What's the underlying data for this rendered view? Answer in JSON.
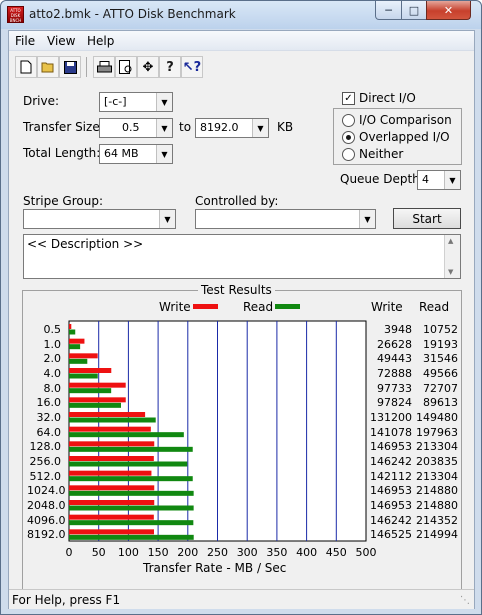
{
  "window": {
    "title": "atto2.bmk - ATTO Disk Benchmark",
    "app_icon_text": "ATTO DISK BNCH"
  },
  "menu": {
    "items": [
      "File",
      "View",
      "Help"
    ]
  },
  "toolbar": {
    "buttons": [
      "new-icon",
      "open-icon",
      "save-icon",
      "print-icon",
      "print-preview-icon",
      "move-icon",
      "help-icon",
      "context-help-icon"
    ]
  },
  "settings": {
    "drive_label": "Drive:",
    "drive_value": "[-c-]",
    "transfer_size_label": "Transfer Size:",
    "transfer_from": "0.5",
    "to_label": "to",
    "transfer_to": "8192.0",
    "kb_label": "KB",
    "total_length_label": "Total Length:",
    "total_length_value": "64 MB",
    "direct_io_label": "Direct I/O",
    "direct_io_checked": true,
    "io_options": [
      {
        "label": "I/O Comparison",
        "selected": false
      },
      {
        "label": "Overlapped I/O",
        "selected": true
      },
      {
        "label": "Neither",
        "selected": false
      }
    ],
    "queue_depth_label": "Queue Depth:",
    "queue_depth_value": "4",
    "stripe_group_label": "Stripe Group:",
    "stripe_group_value": "",
    "controlled_by_label": "Controlled by:",
    "controlled_by_value": "",
    "start_label": "Start",
    "description_text": "<< Description >>"
  },
  "results": {
    "title": "Test Results",
    "legend_write": "Write",
    "legend_read": "Read",
    "col_write": "Write",
    "col_read": "Read",
    "write_color": "#ee1111",
    "read_color": "#118811",
    "grid_color": "#1a2aa8"
  },
  "chart_data": {
    "type": "bar",
    "orientation": "horizontal",
    "categories": [
      "0.5",
      "1.0",
      "2.0",
      "4.0",
      "8.0",
      "16.0",
      "32.0",
      "64.0",
      "128.0",
      "256.0",
      "512.0",
      "1024.0",
      "2048.0",
      "4096.0",
      "8192.0"
    ],
    "series": [
      {
        "name": "Write",
        "values": [
          3948,
          26628,
          49443,
          72888,
          97733,
          97824,
          131200,
          141078,
          146953,
          146242,
          142112,
          146953,
          146953,
          146242,
          146525
        ]
      },
      {
        "name": "Read",
        "values": [
          10752,
          19193,
          31546,
          49566,
          72707,
          89613,
          149480,
          197963,
          213304,
          203835,
          213304,
          214880,
          214880,
          214352,
          214994
        ]
      }
    ],
    "xticks": [
      "0",
      "50",
      "100",
      "150",
      "200",
      "250",
      "300",
      "350",
      "400",
      "450",
      "500"
    ],
    "xlabel": "Transfer Rate - MB / Sec",
    "xlim": [
      0,
      500
    ],
    "grid": true,
    "legend": "top"
  },
  "status": {
    "text": "For Help, press F1"
  }
}
